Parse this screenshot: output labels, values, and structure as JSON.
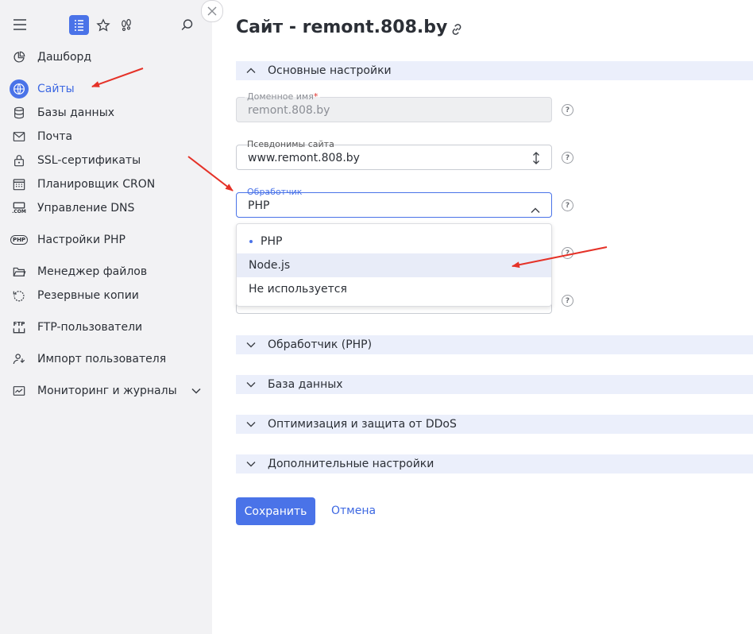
{
  "sidebar": {
    "items": [
      {
        "label": "Дашборд",
        "icon": "pie-chart-icon"
      },
      {
        "label": "Сайты",
        "icon": "globe-icon",
        "active": true
      },
      {
        "label": "Базы данных",
        "icon": "database-icon"
      },
      {
        "label": "Почта",
        "icon": "mail-icon"
      },
      {
        "label": "SSL-сертификаты",
        "icon": "lock-icon"
      },
      {
        "label": "Планировщик CRON",
        "icon": "calendar-icon"
      },
      {
        "label": "Управление DNS",
        "icon": "dns-icon"
      },
      {
        "label": "Настройки PHP",
        "icon": "php-icon"
      },
      {
        "label": "Менеджер файлов",
        "icon": "folder-icon"
      },
      {
        "label": "Резервные копии",
        "icon": "backup-icon"
      },
      {
        "label": "FTP-пользователи",
        "icon": "ftp-icon"
      },
      {
        "label": "Импорт пользователя",
        "icon": "user-import-icon"
      },
      {
        "label": "Мониторинг и журналы",
        "icon": "monitoring-icon"
      }
    ],
    "dns_icon_text": ".COM",
    "php_icon_text": "PHP",
    "ftp_icon_text": "FTP"
  },
  "page": {
    "title": "Сайт - remont.808.by"
  },
  "sections": {
    "main": "Основные настройки",
    "handler_php": "Обработчик (PHP)",
    "database": "База данных",
    "ddos": "Оптимизация и защита от DDoS",
    "extra": "Дополнительные настройки"
  },
  "fields": {
    "domain": {
      "label": "Доменное имя",
      "required_mark": "*",
      "value": "remont.808.by"
    },
    "aliases": {
      "label": "Псевдонимы сайта",
      "value": "www.remont.808.by"
    },
    "handler": {
      "label": "Обработчик",
      "value": "PHP"
    }
  },
  "help_mark": "?",
  "dropdown": {
    "options": [
      "PHP",
      "Node.js",
      "Не используется"
    ],
    "selected": "PHP",
    "hovered": "Node.js"
  },
  "actions": {
    "save": "Сохранить",
    "cancel": "Отмена"
  },
  "colors": {
    "accent": "#4a73e8",
    "annotation_arrow": "#e53228",
    "section_bg": "#ebeffb",
    "sidebar_bg": "#f2f2f4"
  }
}
